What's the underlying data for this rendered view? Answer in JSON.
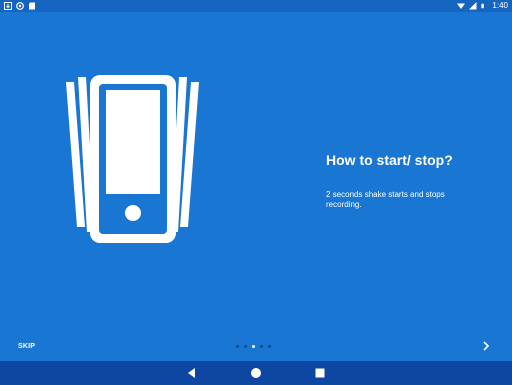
{
  "status_bar": {
    "icons_left": [
      "download-icon",
      "sync-icon",
      "sd-card-icon"
    ],
    "icons_right": [
      "wifi-icon",
      "signal-icon",
      "battery-icon"
    ],
    "time": "1:40"
  },
  "slide": {
    "title": "How to start/ stop?",
    "description": "2 seconds shake starts and stops recording.",
    "illustration_icon": "shaking-phone-icon"
  },
  "pager": {
    "skip_label": "SKIP",
    "page_count": 5,
    "current_page": 3,
    "next_icon": "chevron-right-icon"
  },
  "nav_bar": {
    "buttons": [
      "back-icon",
      "home-icon",
      "recents-icon"
    ]
  },
  "colors": {
    "background": "#1976D2",
    "status_bar": "#1565C0",
    "nav_bar": "#0D47A1",
    "foreground": "#FFFFFF"
  }
}
